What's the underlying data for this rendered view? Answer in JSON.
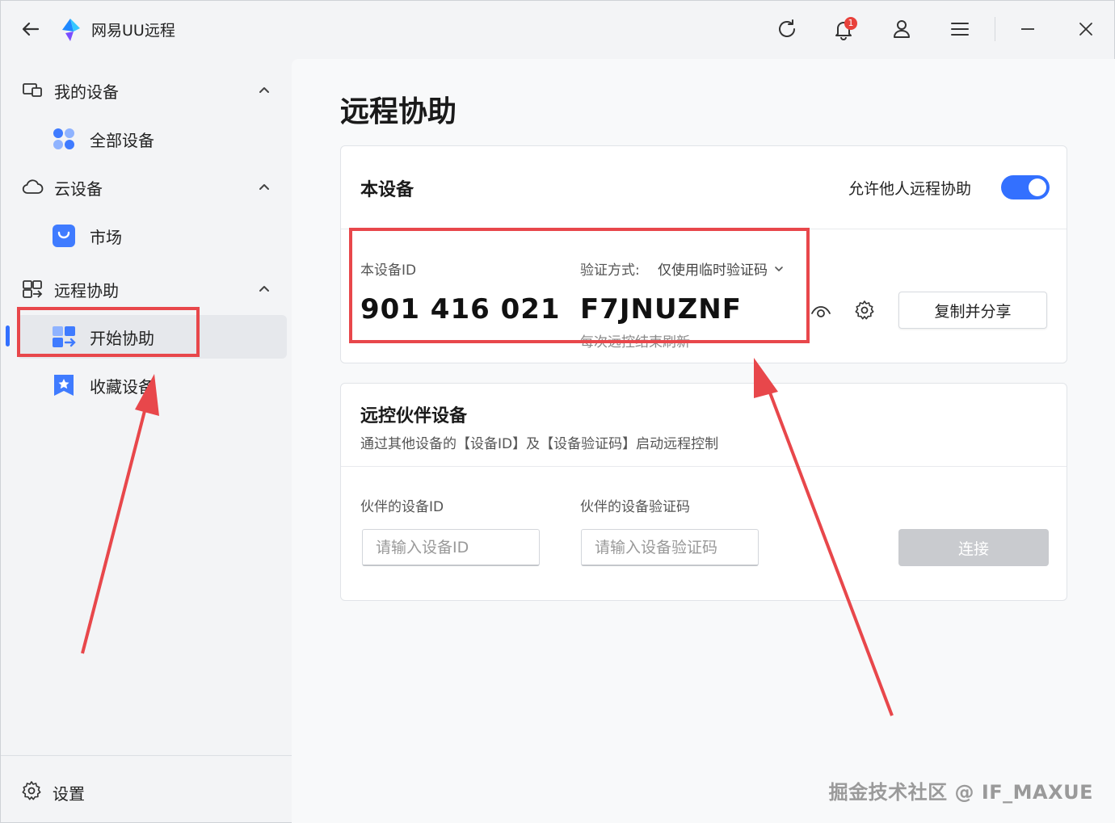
{
  "app": {
    "title": "网易UU远程",
    "notification_count": "1"
  },
  "sidebar": {
    "groups": [
      {
        "label": "我的设备",
        "items": [
          {
            "label": "全部设备"
          }
        ]
      },
      {
        "label": "云设备",
        "items": [
          {
            "label": "市场"
          }
        ]
      },
      {
        "label": "远程协助",
        "items": [
          {
            "label": "开始协助"
          },
          {
            "label": "收藏设备"
          }
        ]
      }
    ],
    "settings_label": "设置"
  },
  "main": {
    "page_title": "远程协助",
    "this_device": {
      "title": "本设备",
      "allow_label": "允许他人远程协助",
      "allow_enabled": true,
      "id_label": "本设备ID",
      "id_value": "901 416 021",
      "verify_label": "验证方式:",
      "verify_method": "仅使用临时验证码",
      "code_value": "F7JNUZNF",
      "refresh_note": "每次远控结束刷新",
      "copy_share_label": "复制并分享"
    },
    "partner": {
      "title": "远控伙伴设备",
      "subtitle": "通过其他设备的【设备ID】及【设备验证码】启动远程控制",
      "id_label": "伙伴的设备ID",
      "id_placeholder": "请输入设备ID",
      "code_label": "伙伴的设备验证码",
      "code_placeholder": "请输入设备验证码",
      "connect_label": "连接"
    }
  },
  "watermark": "掘金技术社区 @ IF_MAXUE",
  "colors": {
    "accent": "#3370ff",
    "annotation": "#e8474b"
  }
}
